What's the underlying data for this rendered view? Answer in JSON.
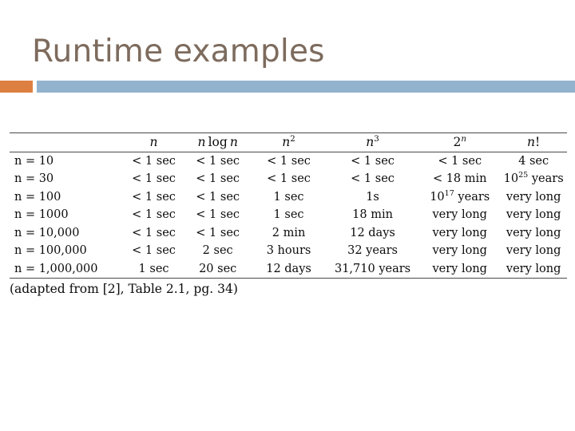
{
  "slide": {
    "title": "Runtime examples",
    "accent_block_color": "#dd7f41",
    "accent_bar_color": "#92b2ce",
    "title_color": "#7d6b5d",
    "background_color": "#ffffff"
  },
  "table": {
    "corner_label": "",
    "headers": [
      {
        "id": "n",
        "label": "n"
      },
      {
        "id": "nlogn",
        "label": "n log n"
      },
      {
        "id": "n2",
        "label": "n2",
        "base": "n",
        "exponent": "2"
      },
      {
        "id": "n3",
        "label": "n3",
        "base": "n",
        "exponent": "3"
      },
      {
        "id": "2n",
        "label": "2n",
        "base": "2",
        "exponent": "n"
      },
      {
        "id": "nfact",
        "label": "n!"
      }
    ],
    "rows": [
      {
        "label": "n = 10",
        "cells": [
          "< 1 sec",
          "< 1 sec",
          "< 1 sec",
          "< 1 sec",
          "< 1 sec",
          "4 sec"
        ]
      },
      {
        "label": "n = 30",
        "cells": [
          "< 1 sec",
          "< 1 sec",
          "< 1 sec",
          "< 1 sec",
          "< 18 min",
          "1025 years"
        ]
      },
      {
        "label": "n = 100",
        "cells": [
          "< 1 sec",
          "< 1 sec",
          "1 sec",
          "1s",
          "1017 years",
          "very long"
        ]
      },
      {
        "label": "n = 1000",
        "cells": [
          "< 1 sec",
          "< 1 sec",
          "1 sec",
          "18 min",
          "very long",
          "very long"
        ]
      },
      {
        "label": "n = 10,000",
        "cells": [
          "< 1 sec",
          "< 1 sec",
          "2 min",
          "12 days",
          "very long",
          "very long"
        ]
      },
      {
        "label": "n = 100,000",
        "cells": [
          "< 1 sec",
          "2 sec",
          "3 hours",
          "32 years",
          "very long",
          "very long"
        ]
      },
      {
        "label": "n = 1,000,000",
        "cells": [
          "1 sec",
          "20 sec",
          "12 days",
          "31,710 years",
          "very long",
          "very long"
        ]
      }
    ],
    "superscript_cells": {
      "r1c5": {
        "mantissa": "10",
        "exponent": "25",
        "suffix": " years"
      },
      "r2c4": {
        "mantissa": "10",
        "exponent": "17",
        "suffix": " years"
      }
    }
  },
  "caption": "(adapted from [2], Table 2.1, pg. 34)"
}
